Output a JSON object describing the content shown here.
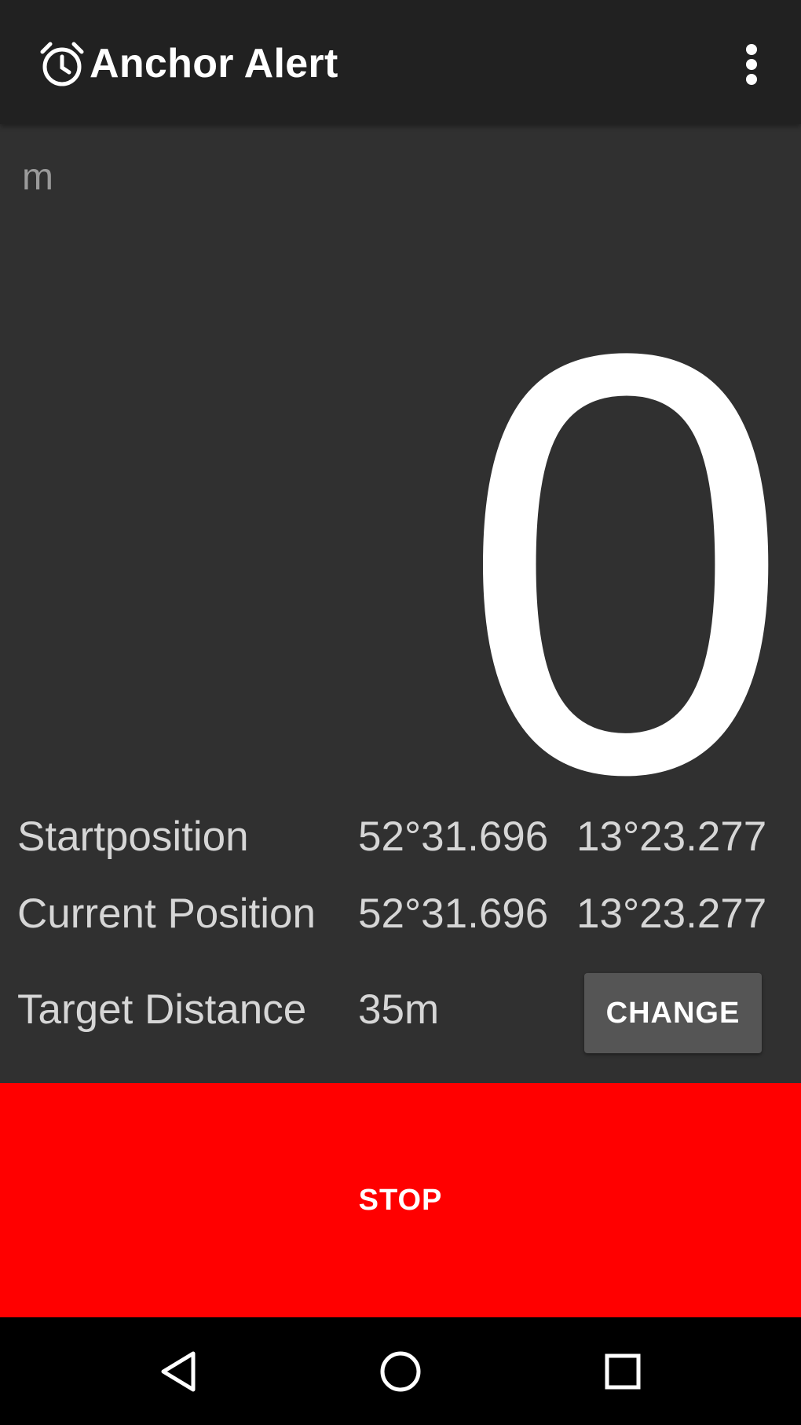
{
  "app_bar": {
    "title": "Anchor Alert",
    "icon": "alarm-clock-icon",
    "menu_icon": "more-vert-icon"
  },
  "distance": {
    "unit": "m",
    "value": "0"
  },
  "start_position": {
    "label": "Startposition",
    "lat": "52°31.696",
    "lon": "13°23.277"
  },
  "current_position": {
    "label": "Current Position",
    "lat": "52°31.696",
    "lon": "13°23.277"
  },
  "target_distance": {
    "label": "Target Distance",
    "value": "35m",
    "change_label": "CHANGE"
  },
  "stop_label": "STOP",
  "nav_bar": {
    "back_icon": "back-triangle-icon",
    "home_icon": "home-circle-icon",
    "recents_icon": "recents-square-icon"
  },
  "colors": {
    "app_bar": "#212121",
    "background": "#303030",
    "stop_button": "#ff0000",
    "change_button": "#555555",
    "nav_bar": "#000000"
  }
}
